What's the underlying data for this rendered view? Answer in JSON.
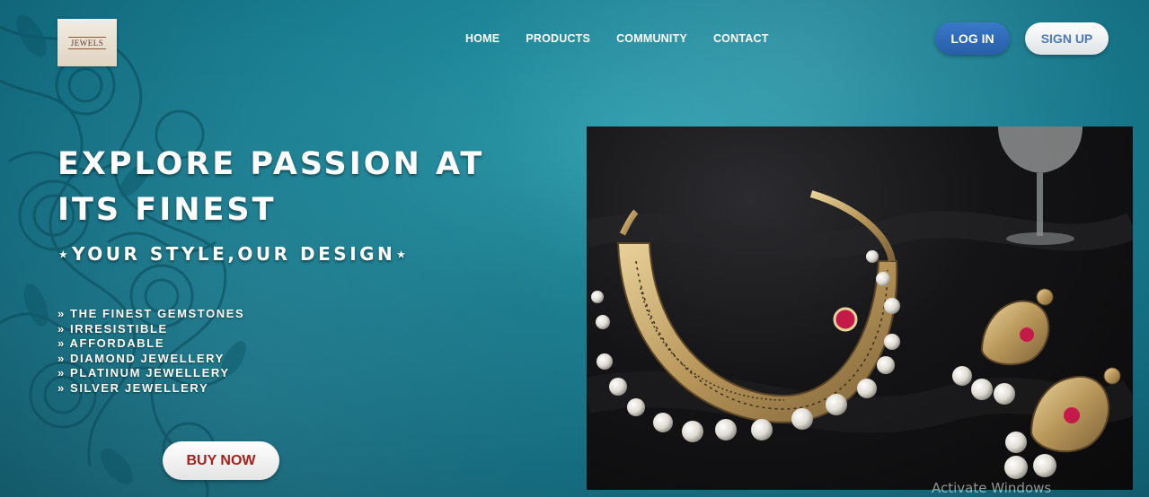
{
  "logo": {
    "text": "JEWELS"
  },
  "nav": {
    "items": [
      {
        "label": "HOME"
      },
      {
        "label": "PRODUCTS"
      },
      {
        "label": "COMMUNITY"
      },
      {
        "label": "CONTACT"
      }
    ]
  },
  "auth": {
    "login_label": "LOG IN",
    "signup_label": "SIGN UP"
  },
  "hero": {
    "title_line1": "EXPLORE PASSION AT",
    "title_line2": "ITS FINEST",
    "tagline": "⋆YOUR STYLE,OUR DESIGN⋆",
    "features": [
      "» THE FINEST GEMSTONES",
      "» IRRESISTIBLE",
      "» AFFORDABLE",
      "» DIAMOND JEWELLERY",
      "» PLATINUM JEWELLERY",
      "» SILVER JEWELLERY"
    ],
    "buy_label": "BUY NOW"
  },
  "os": {
    "watermark": "Activate Windows"
  },
  "colors": {
    "background": "#1c8497",
    "login_button": "#3a78c9",
    "signup_text": "#4d78b6",
    "buy_text": "#a8201a"
  }
}
